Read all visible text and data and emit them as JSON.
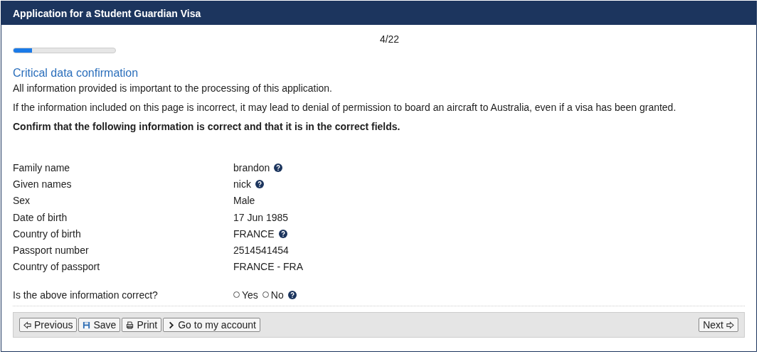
{
  "window": {
    "title": "Application for a Student Guardian Visa"
  },
  "progress": {
    "step": "4/22",
    "level": 0.18
  },
  "section": {
    "heading": "Critical data confirmation",
    "paragraphs": [
      {
        "text": "All information provided is important to the processing of this application.",
        "bold": false
      },
      {
        "text": "If the information included on this page is incorrect, it may lead to denial of permission to board an aircraft to Australia, even if a visa has been granted.",
        "bold": false
      },
      {
        "text": "Confirm that the following information is correct and that it is in the correct fields.",
        "bold": true
      }
    ]
  },
  "fields": [
    {
      "label": "Family name",
      "value": "brandon",
      "help": true
    },
    {
      "label": "Given names",
      "value": "nick",
      "help": true
    },
    {
      "label": "Sex",
      "value": "Male",
      "help": false
    },
    {
      "label": "Date of birth",
      "value": "17 Jun 1985",
      "help": false
    },
    {
      "label": "Country of birth",
      "value": "FRANCE",
      "help": true
    },
    {
      "label": "Passport number",
      "value": "2514541454",
      "help": false
    },
    {
      "label": "Country of passport",
      "value": "FRANCE - FRA",
      "help": false
    }
  ],
  "question": {
    "label": "Is the above information correct?",
    "help": true,
    "options": [
      {
        "label": "Yes",
        "selected": false
      },
      {
        "label": "No",
        "selected": false
      }
    ]
  },
  "footer": {
    "left": [
      {
        "label": "Previous",
        "kind": "back"
      },
      {
        "label": "Save",
        "kind": "save"
      },
      {
        "label": "Print",
        "kind": "print"
      },
      {
        "label": "Go to my account",
        "kind": "chevron"
      }
    ],
    "right": [
      {
        "label": "Next",
        "kind": "next"
      }
    ]
  }
}
